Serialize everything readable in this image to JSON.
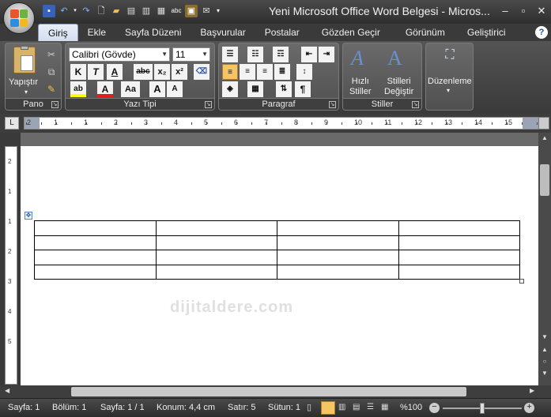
{
  "window": {
    "title": "Yeni Microsoft Office Word Belgesi - Micros...",
    "minimize": "–",
    "restore": "▫",
    "close": "✕"
  },
  "qat": {
    "icons": [
      "save-icon",
      "undo-icon",
      "redo-icon",
      "new-icon",
      "open-icon",
      "print-preview-icon",
      "quick-print-icon",
      "print-icon",
      "spelling-icon",
      "email-icon",
      "customize-icon"
    ]
  },
  "tabs": [
    "Giriş",
    "Ekle",
    "Sayfa Düzeni",
    "Başvurular",
    "Postalar",
    "Gözden Geçir",
    "Görünüm",
    "Geliştirici"
  ],
  "active_tab": "Giriş",
  "help": "?",
  "ribbon": {
    "clipboard": {
      "label": "Pano",
      "paste": "Yapıştır"
    },
    "font": {
      "label": "Yazı Tipi",
      "font_name": "Calibri (Gövde)",
      "font_size": "11",
      "bold": "K",
      "italic": "T",
      "underline": "A",
      "strike": "abc",
      "subscript": "x₂",
      "superscript": "x²",
      "grow": "A",
      "shrink": "A",
      "case": "Aa",
      "highlight": "ab",
      "font_color": "A"
    },
    "paragraph": {
      "label": "Paragraf",
      "show_marks": "¶"
    },
    "styles": {
      "label": "Stiller",
      "quick_styles": "Hızlı\nStiller",
      "change_styles": "Stilleri\nDeğiştir"
    },
    "editing": {
      "label": "Düzenleme"
    }
  },
  "ruler": {
    "numbers": [
      "2",
      "1",
      "1",
      "2",
      "3",
      "4",
      "5",
      "6",
      "7",
      "8",
      "9",
      "10",
      "11",
      "12",
      "13",
      "14",
      "15"
    ],
    "vnumbers": [
      "2",
      "1",
      "1",
      "2",
      "3",
      "4",
      "5"
    ]
  },
  "document": {
    "table": {
      "rows": 4,
      "cols": 4
    },
    "watermark": "dijitaldere.com"
  },
  "statusbar": {
    "page": "Sayfa: 1",
    "section": "Bölüm: 1",
    "pages": "Sayfa: 1 / 1",
    "position": "Konum: 4,4 cm",
    "line": "Satır: 5",
    "column": "Sütun: 1",
    "zoom": "%100",
    "zoom_level": 1.0
  },
  "colors": {
    "accent": "#1c4c9a",
    "titlebar": "#3a3a3a"
  }
}
